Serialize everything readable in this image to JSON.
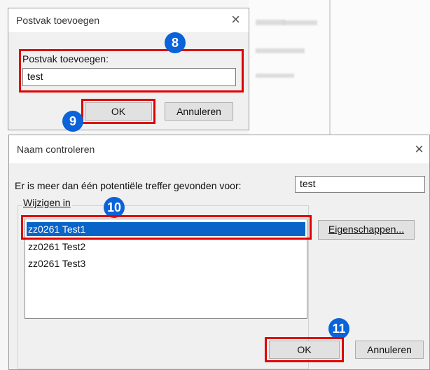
{
  "dialog_add_mailbox": {
    "title": "Postvak toevoegen",
    "field_label": "Postvak toevoegen:",
    "field_value": "test",
    "ok_label": "OK",
    "cancel_label": "Annuleren",
    "badge_field": "8",
    "badge_ok": "9"
  },
  "dialog_check_name": {
    "title": "Naam controleren",
    "match_text": "Er is meer dan één potentiële treffer gevonden voor:",
    "match_value": "test",
    "group_label": "Wijzigen in",
    "items": [
      "zz0261 Test1",
      "zz0261 Test2",
      "zz0261 Test3"
    ],
    "properties_label": "Eigenschappen...",
    "ok_label": "OK",
    "cancel_label": "Annuleren",
    "badge_selection": "10",
    "badge_ok": "11"
  },
  "icons": {
    "close": "close-icon"
  },
  "colors": {
    "annotation_red": "#e00000",
    "badge_blue": "#0a63d8",
    "selection_blue": "#0a64c8"
  }
}
